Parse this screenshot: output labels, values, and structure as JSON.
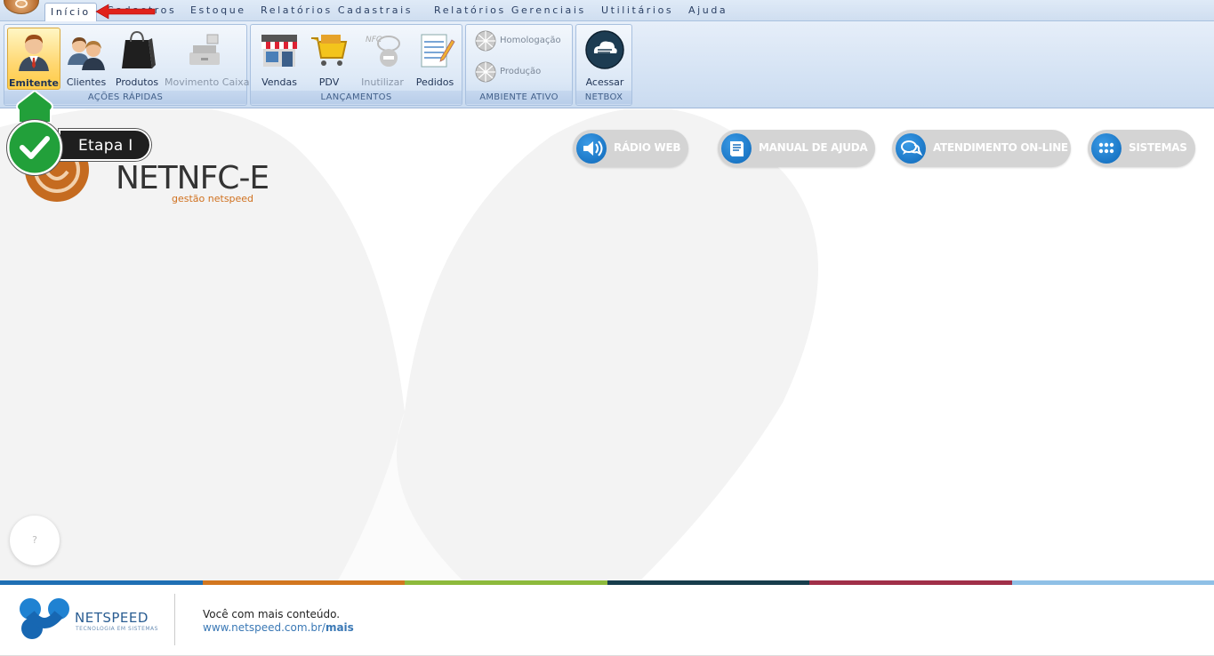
{
  "menu": {
    "tabs": [
      "Início",
      "Cadastros",
      "Estoque",
      "Relatórios Cadastrais",
      "Relatórios Gerenciais",
      "Utilitários",
      "Ajuda"
    ],
    "active_tab": "Início"
  },
  "ribbon": {
    "groups": [
      {
        "label": "AÇÕES RÁPIDAS",
        "buttons": [
          {
            "label": "Emitente",
            "icon": "businessman-icon",
            "state": "selected"
          },
          {
            "label": "Clientes",
            "icon": "users-icon",
            "state": "normal"
          },
          {
            "label": "Produtos",
            "icon": "shopping-bag-icon",
            "state": "normal"
          },
          {
            "label": "Movimento Caixa",
            "icon": "cash-register-icon",
            "state": "disabled"
          }
        ]
      },
      {
        "label": "LANÇAMENTOS",
        "buttons": [
          {
            "label": "Vendas",
            "icon": "storefront-icon",
            "state": "normal"
          },
          {
            "label": "PDV",
            "icon": "shopping-cart-icon",
            "state": "normal"
          },
          {
            "label": "Inutilizar",
            "icon": "nfce-cancel-icon",
            "state": "disabled"
          },
          {
            "label": "Pedidos",
            "icon": "order-sheet-icon",
            "state": "normal"
          }
        ]
      },
      {
        "label": "AMBIENTE ATIVO",
        "buttons": [
          {
            "label": "Homologação",
            "icon": "globe-icon",
            "state": "disabled"
          },
          {
            "label": "Produção",
            "icon": "globe-icon",
            "state": "disabled"
          }
        ]
      },
      {
        "label": "NETBOX",
        "buttons": [
          {
            "label": "Acessar",
            "icon": "netbox-cloud-icon",
            "state": "normal"
          }
        ]
      }
    ]
  },
  "logo": {
    "title": "NETNFC-E",
    "subtitle": "gestão netspeed"
  },
  "quick_links": [
    {
      "label": "RÁDIO WEB",
      "icon": "speaker-icon"
    },
    {
      "label": "MANUAL DE AJUDA",
      "icon": "book-icon"
    },
    {
      "label": "ATENDIMENTO ON-LINE",
      "icon": "chat-icon"
    },
    {
      "label": "SISTEMAS",
      "icon": "apps-grid-icon"
    }
  ],
  "help_bubble": "?",
  "callout": {
    "label": "Etapa I"
  },
  "footer": {
    "brand": "NETSPEED",
    "tagline": "TECNOLOGIA EM SISTEMAS",
    "text": "Você com mais conteúdo.",
    "link_prefix": "www.netspeed.com.br/",
    "link_bold": "mais"
  },
  "colors": {
    "stripes": [
      "#1f6fb4",
      "#d2761f",
      "#8dba3c",
      "#173d4c",
      "#a02f48",
      "#8fc0e6"
    ],
    "accent_blue": "#0d67b8",
    "callout_green": "#22a03a"
  }
}
